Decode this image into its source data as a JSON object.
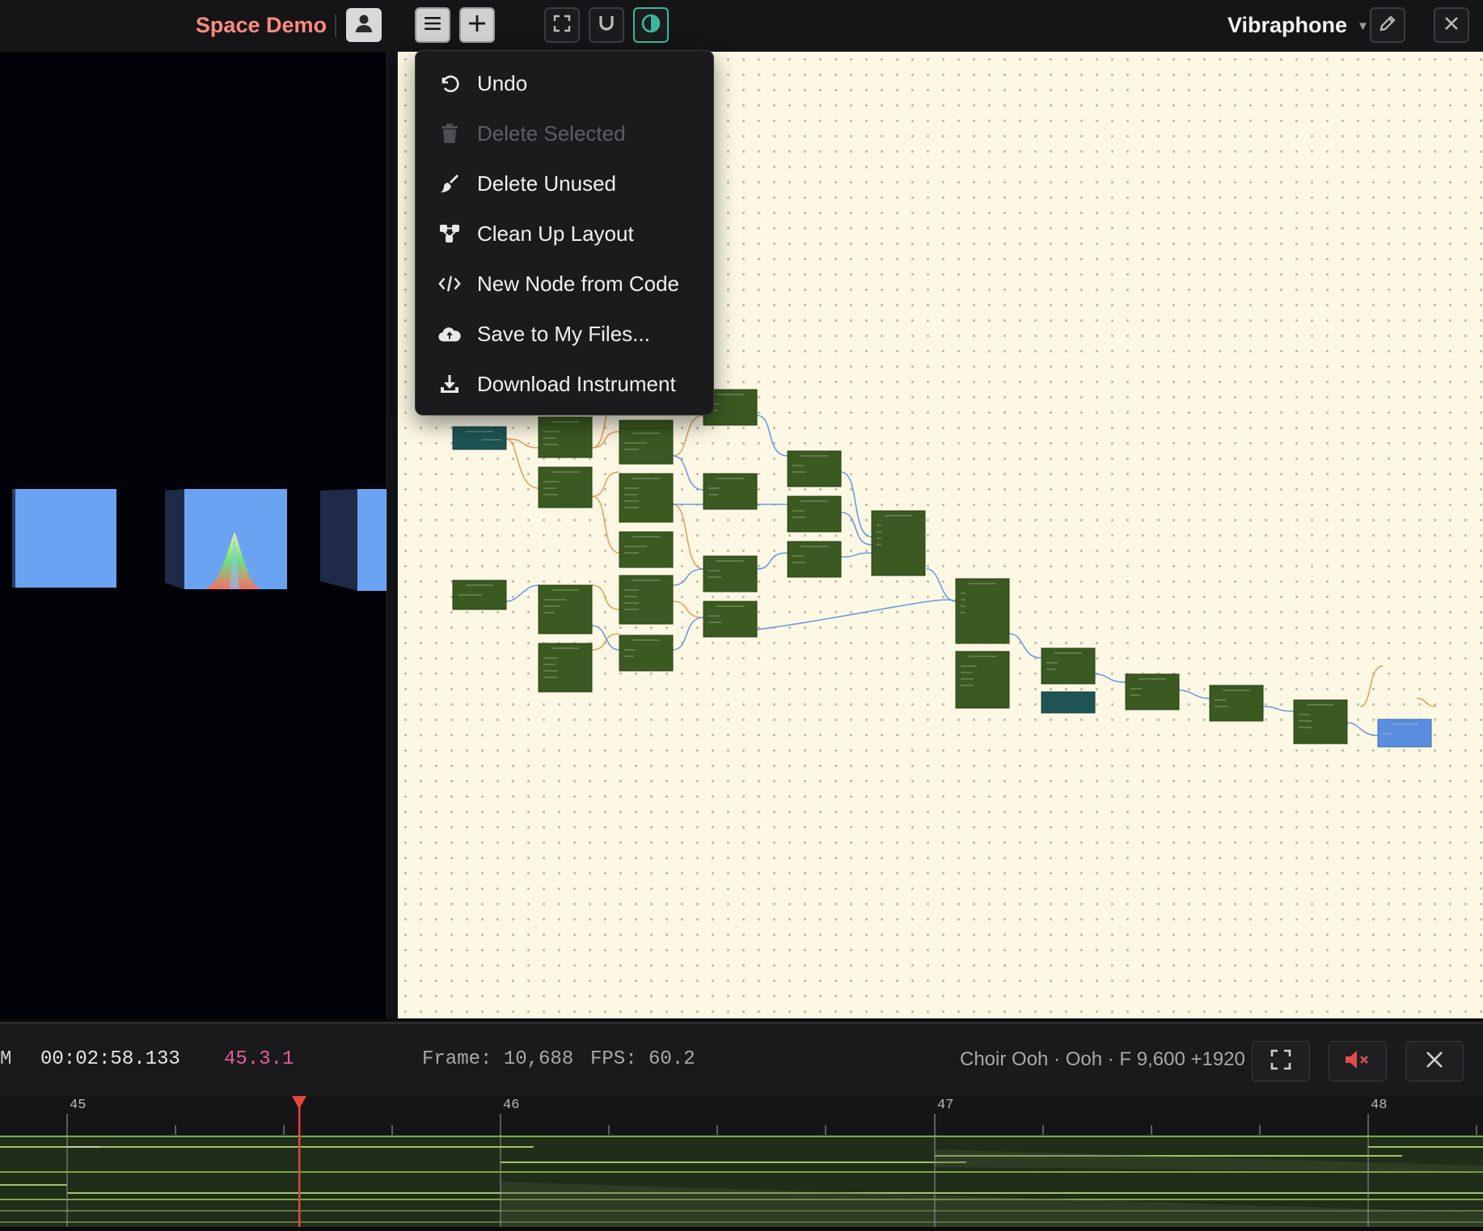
{
  "header": {
    "project_title": "Space Demo",
    "instrument_name": "Vibraphone",
    "toolbar_icons": [
      "menu-icon",
      "plus-icon",
      "fullscreen-icon",
      "magnet-icon",
      "contrast-icon",
      "pencil-icon",
      "close-icon",
      "user-icon"
    ]
  },
  "menu": {
    "items": [
      {
        "label": "Undo",
        "icon": "undo-icon",
        "enabled": true
      },
      {
        "label": "Delete Selected",
        "icon": "trash-icon",
        "enabled": false
      },
      {
        "label": "Delete Unused",
        "icon": "broom-icon",
        "enabled": true
      },
      {
        "label": "Clean Up Layout",
        "icon": "layout-icon",
        "enabled": true
      },
      {
        "label": "New Node from Code",
        "icon": "code-icon",
        "enabled": true
      },
      {
        "label": "Save to My Files...",
        "icon": "cloud-upload-icon",
        "enabled": true
      },
      {
        "label": "Download Instrument",
        "icon": "download-icon",
        "enabled": true
      }
    ]
  },
  "status": {
    "mode_letter": "M",
    "time": "00:02:58.133",
    "position": "45.3.1",
    "frame": "Frame: 10,688",
    "fps": "FPS: 60.2",
    "patch_info": "Choir Ooh · Ooh · F 9,600 +1920"
  },
  "timeline": {
    "bar_labels": [
      "45",
      "46",
      "47",
      "48"
    ]
  },
  "colors": {
    "accent_title": "#ff8a80",
    "accent_teal": "#39b79d",
    "position_pink": "#e35d9f",
    "playhead": "#e8453c",
    "node_green": "#3b5a22",
    "node_teal": "#1f5454",
    "output_blue": "#5a8fe0",
    "canvas_bg": "#fdf8e4"
  }
}
